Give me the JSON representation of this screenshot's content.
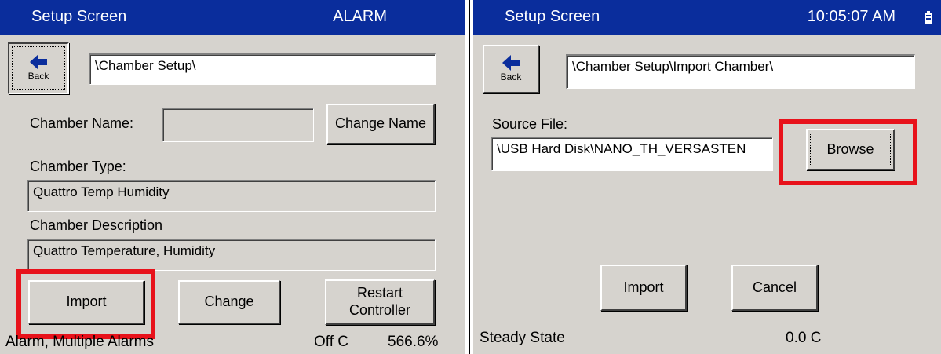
{
  "colors": {
    "titlebar": "#0a2d9c",
    "panel": "#d6d3ce",
    "highlight": "#e8121b"
  },
  "left": {
    "title": "Setup Screen",
    "title_right": "ALARM",
    "back_label": "Back",
    "path": "\\Chamber Setup\\",
    "chamber_name_label": "Chamber Name:",
    "chamber_name_value": "",
    "change_name_label": "Change Name",
    "chamber_type_label": "Chamber Type:",
    "chamber_type_value": "Quattro Temp Humidity",
    "chamber_desc_label": "Chamber Description",
    "chamber_desc_value": "Quattro Temperature, Humidity",
    "import_label": "Import",
    "change_label": "Change",
    "restart_line1": "Restart",
    "restart_line2": "Controller",
    "status_text": "Alarm, Multiple Alarms",
    "status_temp": "Off C",
    "status_humidity": "566.6%"
  },
  "right": {
    "title": "Setup Screen",
    "clock": "10:05:07 AM",
    "status_icon": "battery-icon",
    "back_label": "Back",
    "path": "\\Chamber Setup\\Import Chamber\\",
    "source_label": "Source File:",
    "source_value": "\\USB Hard Disk\\NANO_TH_VERSASTEN",
    "browse_label": "Browse",
    "import_label": "Import",
    "cancel_label": "Cancel",
    "status_text": "Steady State",
    "status_temp": "0.0 C"
  }
}
